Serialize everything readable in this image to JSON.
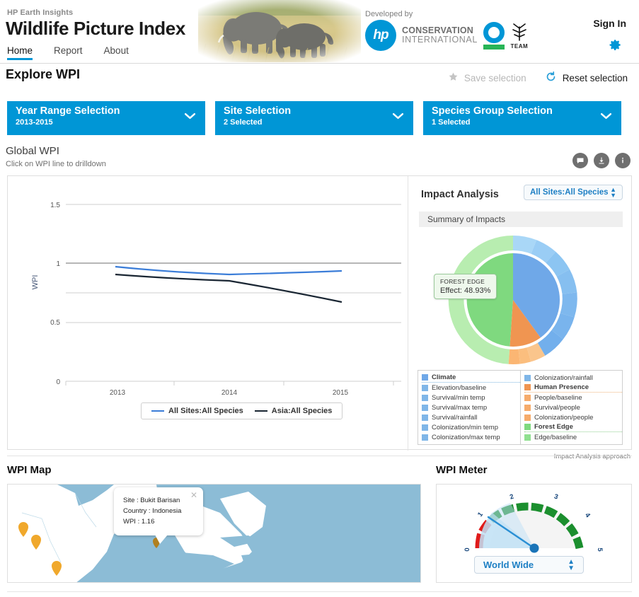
{
  "header": {
    "brand_sub": "HP Earth Insights",
    "brand_title": "Wildlife Picture Index",
    "nav": [
      {
        "label": "Home",
        "active": true
      },
      {
        "label": "Report",
        "active": false
      },
      {
        "label": "About",
        "active": false
      }
    ],
    "developed_by": "Developed by",
    "hp_logo_text": "hp",
    "ci_line1": "CONSERVATION",
    "ci_line2": "INTERNATIONAL",
    "team_label": "TEAM",
    "sign_in": "Sign In",
    "gear_icon": "gear-icon",
    "banner_alt": "elephants"
  },
  "explore": {
    "title": "Explore WPI",
    "save_label": "Save selection",
    "reset_label": "Reset selection",
    "save_icon": "star-icon",
    "reset_icon": "reset-circular-arrow-icon"
  },
  "selectors": [
    {
      "title": "Year Range Selection",
      "value": "2013-2015",
      "icon": "chevron-down-icon"
    },
    {
      "title": "Site Selection",
      "value": "2 Selected",
      "icon": "chevron-down-icon"
    },
    {
      "title": "Species Group Selection",
      "value": "1 Selected",
      "icon": "chevron-down-icon"
    }
  ],
  "global_wpi": {
    "title": "Global WPI",
    "subtitle": "Click on WPI line to drilldown",
    "icons": [
      "comment-icon",
      "download-icon",
      "info-icon"
    ]
  },
  "chart_data": {
    "type": "line",
    "title": "Global WPI",
    "xlabel": "",
    "ylabel": "WPI",
    "categories": [
      "2013",
      "2014",
      "2015"
    ],
    "x": [
      2013,
      2014,
      2015
    ],
    "ylim": [
      0,
      1.5
    ],
    "yticks": [
      0,
      0.5,
      1,
      1.5
    ],
    "ytick_labels": [
      "0",
      "0.5",
      "1",
      "1.5"
    ],
    "grid": true,
    "legend_position": "bottom",
    "series": [
      {
        "name": "All Sites:All Species",
        "color": "#3b7dd8",
        "values": [
          0.97,
          0.92,
          0.94
        ]
      },
      {
        "name": "Asia:All Species",
        "color": "#1a2633",
        "values": [
          0.92,
          0.89,
          0.72
        ]
      }
    ],
    "reference_line": {
      "value": 1.0,
      "color": "#8a8a8a"
    }
  },
  "impact": {
    "title": "Impact Analysis",
    "selected_scope": "All Sites:All Species",
    "scope_icon": "updown-spinner-icon",
    "summary_label": "Summary of Impacts",
    "approach_label": "Impact Analysis approach",
    "tooltip": {
      "name": "FOREST EDGE",
      "effect": "Effect: 48.93%"
    },
    "donut": {
      "type": "pie",
      "inner_ring": [
        {
          "name": "Forest Edge",
          "value": 48.93,
          "color": "#7fd97f"
        },
        {
          "name": "Climate",
          "value": 40.0,
          "color": "#6fa8e8"
        },
        {
          "name": "Human Presence",
          "value": 11.07,
          "color": "#f09551"
        }
      ],
      "outer_ring": [
        {
          "name": "Edge/baseline",
          "value": 48.93,
          "color": "#b8edb0"
        },
        {
          "name": "Elevation/baseline",
          "value": 6.0,
          "color": "#a9d7f7"
        },
        {
          "name": "Survival/min temp",
          "value": 6.5,
          "color": "#9acdf5"
        },
        {
          "name": "Survival/max temp",
          "value": 6.0,
          "color": "#8cc5f2"
        },
        {
          "name": "Survival/rainfall",
          "value": 6.5,
          "color": "#86bff0"
        },
        {
          "name": "Colonization/min temp",
          "value": 6.0,
          "color": "#7eb8ee"
        },
        {
          "name": "Colonization/max temp",
          "value": 6.0,
          "color": "#79b4ed"
        },
        {
          "name": "Colonization/rainfall",
          "value": 6.0,
          "color": "#72afec"
        },
        {
          "name": "People/baseline",
          "value": 3.7,
          "color": "#fac58c"
        },
        {
          "name": "Survival/people",
          "value": 3.7,
          "color": "#fbbe7e"
        },
        {
          "name": "Colonization/people",
          "value": 3.7,
          "color": "#fbb673"
        }
      ]
    },
    "legend_left": [
      {
        "label": "Climate",
        "color": "#6fa8e8",
        "head": true
      },
      {
        "label": "Elevation/baseline",
        "color": "#7fb6e8",
        "head": false
      },
      {
        "label": "Survival/min temp",
        "color": "#7fb6e8",
        "head": false
      },
      {
        "label": "Survival/max temp",
        "color": "#7fb6e8",
        "head": false
      },
      {
        "label": "Survival/rainfall",
        "color": "#7fb6e8",
        "head": false
      },
      {
        "label": "Colonization/min temp",
        "color": "#7fb6e8",
        "head": false
      },
      {
        "label": "Colonization/max temp",
        "color": "#7fb6e8",
        "head": false
      }
    ],
    "legend_right": [
      {
        "label": "Colonization/rainfall",
        "color": "#7fb6e8",
        "head": false
      },
      {
        "label": "Human Presence",
        "color": "#f09551",
        "head": true
      },
      {
        "label": "People/baseline",
        "color": "#f6ab6b",
        "head": false
      },
      {
        "label": "Survival/people",
        "color": "#f6ab6b",
        "head": false
      },
      {
        "label": "Colonization/people",
        "color": "#f6ab6b",
        "head": false
      },
      {
        "label": "Forest Edge",
        "color": "#7fd97f",
        "head": true
      },
      {
        "label": "Edge/baseline",
        "color": "#8fe08f",
        "head": false
      }
    ]
  },
  "map": {
    "title": "WPI Map",
    "popup": {
      "site": "Site : Bukit Barisan",
      "country": "Country : Indonesia",
      "wpi": "WPI : 1.16",
      "close_icon": "close-icon"
    },
    "marker_icon": "map-pin-icon",
    "markers": 4
  },
  "meter": {
    "title": "WPI Meter",
    "selected": "World Wide",
    "select_icon": "updown-spinner-icon",
    "gauge": {
      "type": "gauge",
      "min": 0,
      "max": 5,
      "value": 1.16,
      "tick_labels": [
        "0",
        "1",
        "2",
        "3",
        "4",
        "5"
      ],
      "bands": [
        {
          "from": 0,
          "to": 1,
          "color": "#e01b1b"
        },
        {
          "from": 1,
          "to": 5,
          "color": "#1b8f2e"
        }
      ],
      "needle_color": "#2a8fd4"
    }
  },
  "colors": {
    "brand_blue": "#0096d6",
    "accent_green": "#28b457",
    "text_dark": "#1a1a1a",
    "muted": "#8a8a8a"
  }
}
